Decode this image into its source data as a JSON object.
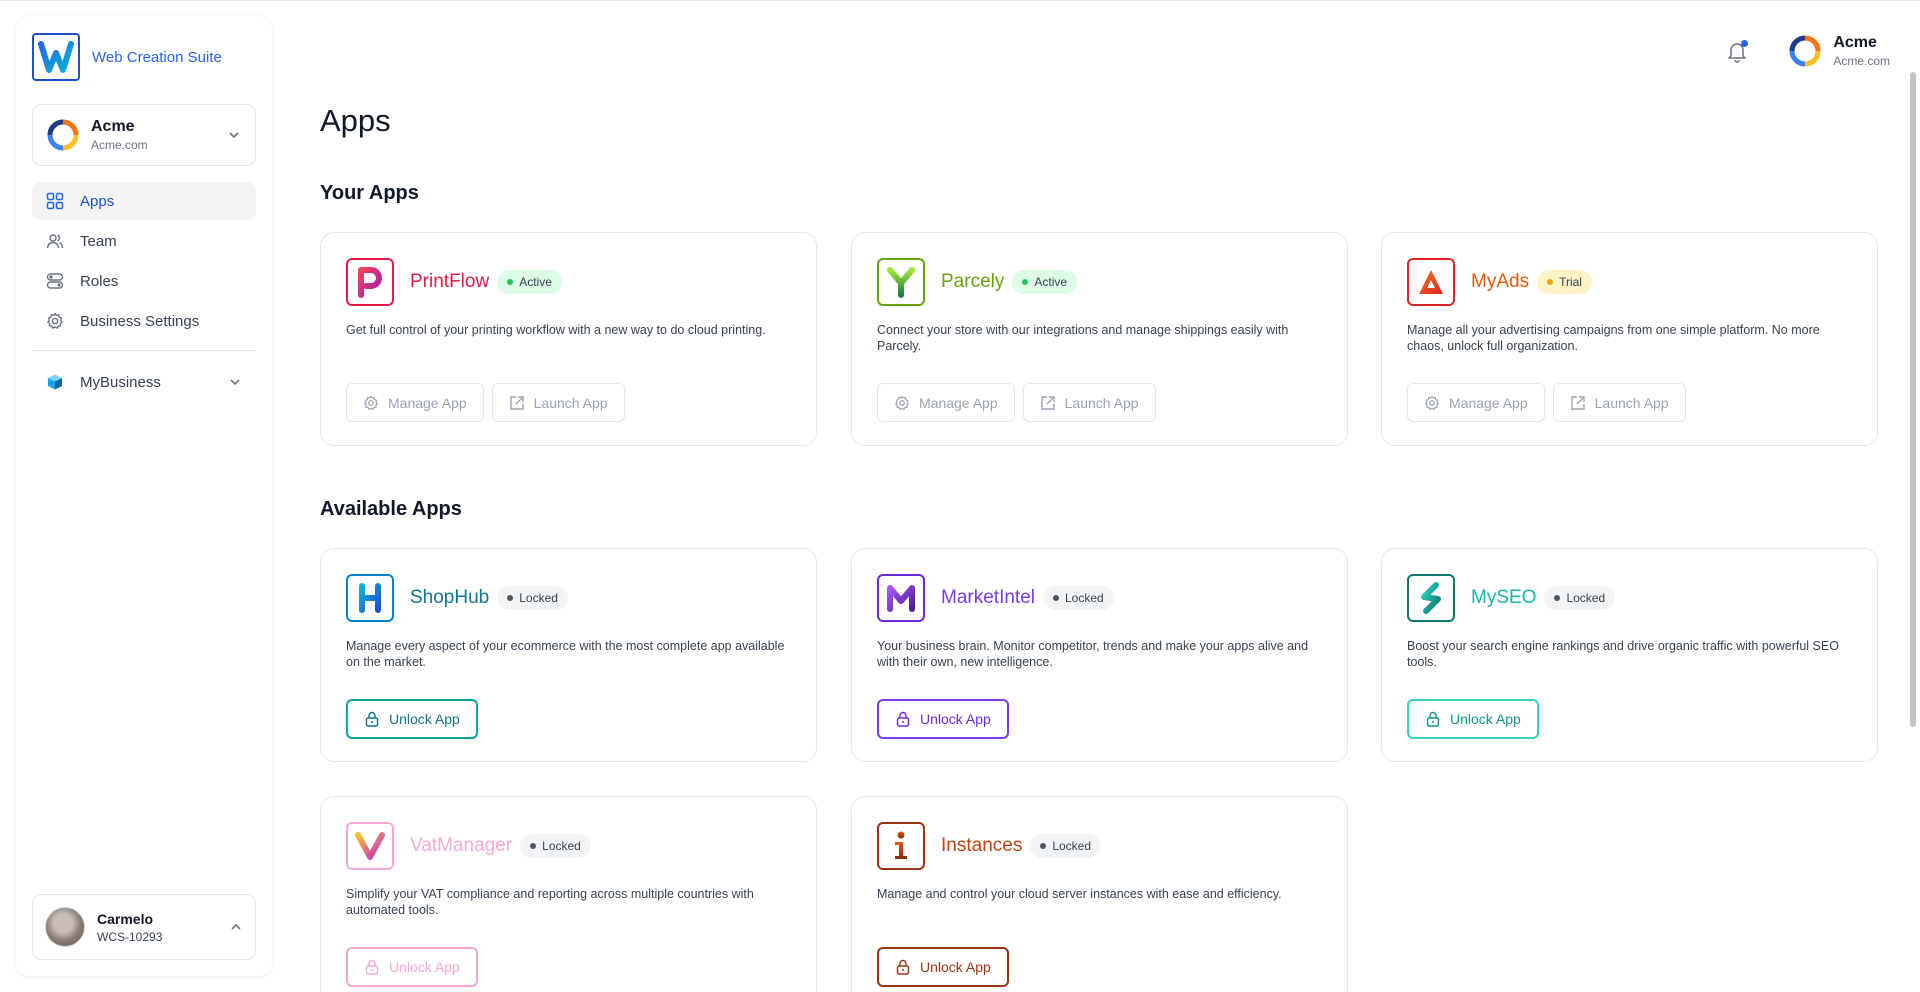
{
  "brand": {
    "name": "Web Creation Suite"
  },
  "org_switcher": {
    "name": "Acme",
    "domain": "Acme.com"
  },
  "nav": {
    "items": [
      {
        "label": "Apps",
        "icon": "grid-icon"
      },
      {
        "label": "Team",
        "icon": "users-icon"
      },
      {
        "label": "Roles",
        "icon": "toggles-icon"
      },
      {
        "label": "Business Settings",
        "icon": "gear-icon"
      }
    ],
    "business": {
      "label": "MyBusiness",
      "icon": "cube-icon"
    }
  },
  "user": {
    "name": "Carmelo",
    "id": "WCS-10293"
  },
  "header": {
    "account_name": "Acme",
    "account_domain": "Acme.com",
    "notification_icon": "bell-icon"
  },
  "page": {
    "title": "Apps",
    "your_apps_title": "Your Apps",
    "available_apps_title": "Available Apps"
  },
  "buttons": {
    "manage": "Manage App",
    "launch": "Launch App",
    "unlock": "Unlock App"
  },
  "your_apps": [
    {
      "name": "PrintFlow",
      "status": "Active",
      "description": "Get full control of your printing workflow with a new way to do cloud printing.",
      "color": "#e11d48"
    },
    {
      "name": "Parcely",
      "status": "Active",
      "description": "Connect your store with our integrations and manage shippings easily with Parcely.",
      "color": "#65a30d"
    },
    {
      "name": "MyAds",
      "status": "Trial",
      "description": "Manage all your advertising campaigns from one simple platform. No more chaos, unlock full organization.",
      "color": "#ea580c"
    }
  ],
  "available_apps": [
    {
      "name": "ShopHub",
      "status": "Locked",
      "description": "Manage every aspect of your ecommerce with the most complete app available on the market.",
      "color": "#0ea5e9"
    },
    {
      "name": "MarketIntel",
      "status": "Locked",
      "description": "Your business brain. Monitor competitor, trends and make your apps alive and with their own, new intelligence.",
      "color": "#7c3aed"
    },
    {
      "name": "MySEO",
      "status": "Locked",
      "description": "Boost your search engine rankings and drive organic traffic with powerful SEO tools.",
      "color": "#14b8a6"
    },
    {
      "name": "VatManager",
      "status": "Locked",
      "description": "Simplify your VAT compliance and reporting across multiple countries with automated tools.",
      "color": "#ec4899"
    },
    {
      "name": "Instances",
      "status": "Locked",
      "description": "Manage and control your cloud server instances with ease and efficiency.",
      "color": "#c2410c"
    }
  ]
}
